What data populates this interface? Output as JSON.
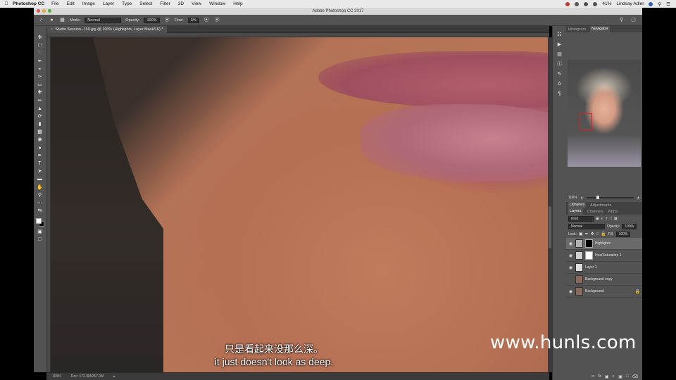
{
  "menubar": {
    "apple_icon": "apple-icon",
    "app_name": "Photoshop CC",
    "menus": [
      "File",
      "Edit",
      "Image",
      "Layer",
      "Type",
      "Select",
      "Filter",
      "3D",
      "View",
      "Window",
      "Help"
    ],
    "battery": "41%",
    "user": "Lindsay Adler"
  },
  "window": {
    "title": "Adobe Photoshop CC 2017"
  },
  "options_bar": {
    "mode_label": "Mode:",
    "mode_value": "Normal",
    "opacity_label": "Opacity:",
    "opacity_value": "100%",
    "flow_label": "Flow:",
    "flow_value": "3%"
  },
  "document": {
    "tab_title": "Studio Session--150.jpg @ 100% (Highlights, Layer Mask/16) *",
    "zoom": "100%",
    "doc_size": "Doc: 172.9M/257.0M"
  },
  "subtitles": {
    "chinese": "只是看起来没那么深。",
    "english": "it just doesn't look as deep."
  },
  "watermark": "www.hunls.com",
  "navigator": {
    "tabs": [
      "Histogram",
      "Navigator"
    ],
    "active_tab": "Navigator",
    "zoom": "100%"
  },
  "layers_panel": {
    "top_tabs": [
      "Libraries",
      "Adjustments"
    ],
    "tabs": [
      "Layers",
      "Channels",
      "Paths"
    ],
    "active_tab": "Layers",
    "filter_kind": "Kind",
    "blend_mode": "Normal",
    "opacity_label": "Opacity:",
    "opacity_value": "100%",
    "lock_label": "Lock:",
    "fill_label": "Fill:",
    "fill_value": "100%",
    "layers": [
      {
        "name": "Highlights",
        "selected": true,
        "thumb_color": "#b0b0b0",
        "mask_color": "#000000"
      },
      {
        "name": "Hue/Saturation 1",
        "selected": false,
        "thumb_color": "#d0d0d0",
        "mask_color": "#ffffff"
      },
      {
        "name": "Layer 1",
        "selected": false,
        "thumb_color": "#dddddd",
        "mask_color": ""
      },
      {
        "name": "Background copy",
        "selected": false,
        "thumb_color": "#8a6a5a",
        "mask_color": ""
      },
      {
        "name": "Background",
        "selected": false,
        "thumb_color": "#8a6a5a",
        "mask_color": "",
        "locked": true
      }
    ]
  }
}
